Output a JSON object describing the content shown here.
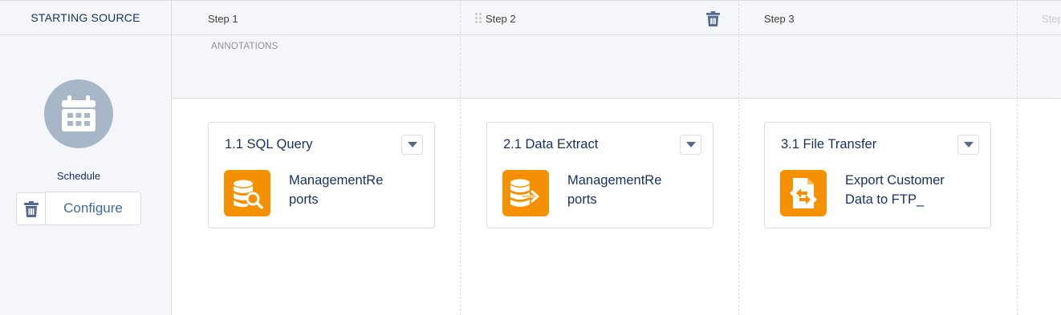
{
  "source": {
    "header": "STARTING SOURCE",
    "schedule_label": "Schedule",
    "configure_label": "Configure",
    "schedule_icon": "calendar-icon"
  },
  "steps": [
    {
      "title": "Step 1"
    },
    {
      "title": "Step 2"
    },
    {
      "title": "Step 3"
    },
    {
      "title": "Step"
    }
  ],
  "annotations_label": "ANNOTATIONS",
  "activities": [
    {
      "title": "1.1 SQL Query",
      "name_line1": "ManagementRe",
      "name_line2": "ports",
      "icon": "sql-query-icon"
    },
    {
      "title": "2.1 Data Extract",
      "name_line1": "ManagementRe",
      "name_line2": "ports",
      "icon": "data-extract-icon"
    },
    {
      "title": "3.1 File Transfer",
      "name_line1": "Export Customer",
      "name_line2": "Data to FTP_",
      "icon": "file-transfer-icon"
    }
  ],
  "colors": {
    "accent_orange": "#f59100",
    "circle_gray": "#a8b7c7",
    "text_navy": "#16325c",
    "panel_bg": "#f4f6f9"
  }
}
